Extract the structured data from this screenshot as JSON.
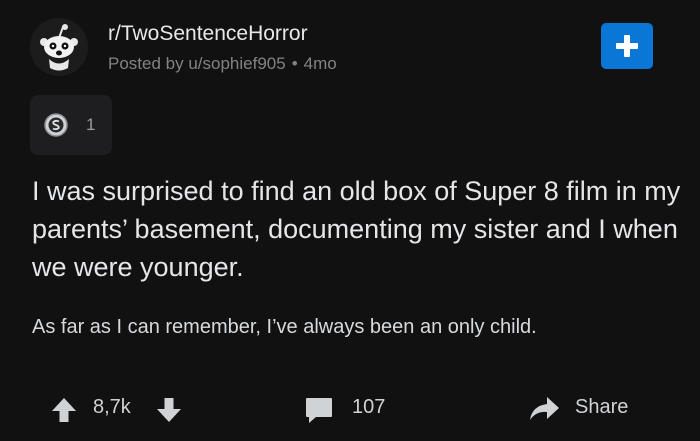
{
  "post": {
    "subreddit": "r/TwoSentenceHorror",
    "posted_by": "Posted by u/sophief905",
    "age": "4mo",
    "award_count": "1",
    "title": "I was surprised to find an old box of Super 8 film in my parents’ basement, documenting my sister and I when we were younger.",
    "body": "As far as I can remember, I’ve always been an only child."
  },
  "actions": {
    "votes": "8,7k",
    "comments": "107",
    "share_label": "Share"
  },
  "icons": {
    "avatar": "snoo-avatar-icon",
    "join": "plus-icon",
    "award": "silver-award-icon",
    "upvote": "arrow-up-icon",
    "downvote": "arrow-down-icon",
    "comments": "comment-bubble-icon",
    "share": "share-arrow-icon"
  },
  "colors": {
    "background": "#111112",
    "join_button": "#0a76d6",
    "muted_text": "#818384",
    "primary_text": "#e4e6e8"
  }
}
